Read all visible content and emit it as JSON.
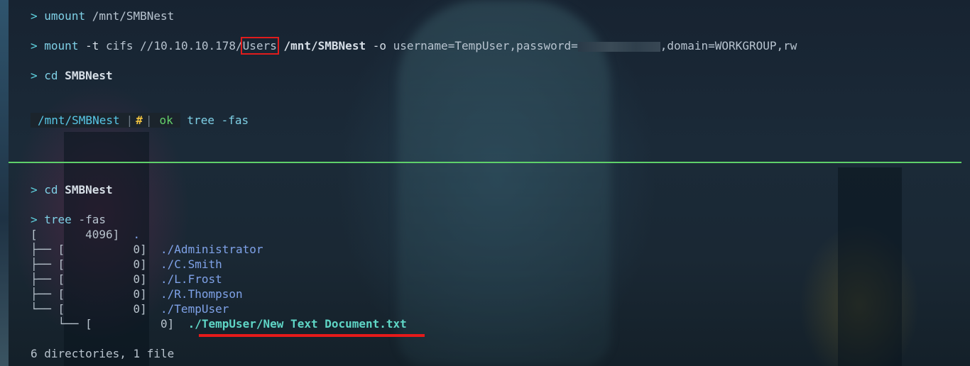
{
  "prompt_symbol": ">",
  "top": {
    "cmd1": {
      "cmd": "umount",
      "arg": "/mnt/SMBNest"
    },
    "cmd2": {
      "cmd": "mount",
      "flag": "-t",
      "fs": "cifs",
      "share_prefix": "//10.10.10.178/",
      "share": "Users",
      "mountpoint": "/mnt/SMBNest",
      "opt_flag": "-o",
      "opts_prefix": "username=TempUser,password=",
      "opts_suffix": ",domain=WORKGROUP,rw"
    },
    "cmd3": {
      "cmd": "cd",
      "arg": "SMBNest"
    },
    "status": {
      "path": "/mnt/SMBNest",
      "sep": "|",
      "hash": "#",
      "ok": "ok",
      "command": "tree -fas"
    }
  },
  "bottom": {
    "cmd1": {
      "cmd": "cd",
      "arg": "SMBNest"
    },
    "cmd2": {
      "cmd": "tree",
      "arg": "-fas"
    },
    "tree": {
      "root": {
        "bracket": "[",
        "size": "4096]",
        "name": "."
      },
      "entries": [
        {
          "prefix": "├── [",
          "size": "0]",
          "name": "./Administrator"
        },
        {
          "prefix": "├── [",
          "size": "0]",
          "name": "./C.Smith"
        },
        {
          "prefix": "├── [",
          "size": "0]",
          "name": "./L.Frost"
        },
        {
          "prefix": "├── [",
          "size": "0]",
          "name": "./R.Thompson"
        },
        {
          "prefix": "└── [",
          "size": "0]",
          "name": "./TempUser"
        }
      ],
      "child": {
        "prefix": "└── [",
        "size": "0]",
        "name": "./TempUser/New Text Document.txt"
      }
    },
    "summary": "6 directories, 1 file"
  },
  "colors": {
    "divider": "#5fd06a",
    "highlight": "#e01c1c",
    "prompt": "#5fd3e0"
  }
}
